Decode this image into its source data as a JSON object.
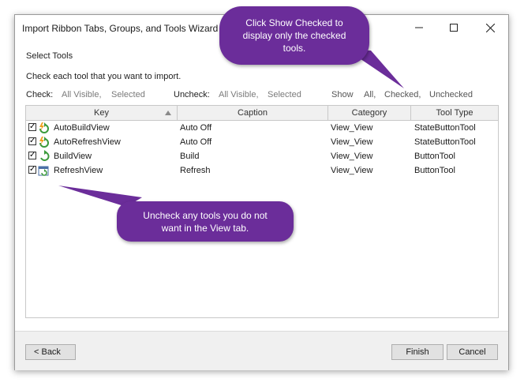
{
  "window": {
    "title": "Import Ribbon Tabs, Groups, and Tools Wizard",
    "controls": {
      "minimize": "—",
      "maximize": "☐",
      "close": "✕"
    }
  },
  "page": {
    "heading": "Select Tools",
    "instruction": "Check each tool that you want to import."
  },
  "filters": {
    "check_label": "Check:",
    "check_all_visible": "All Visible,",
    "check_selected": "Selected",
    "uncheck_label": "Uncheck:",
    "uncheck_all_visible": "All Visible,",
    "uncheck_selected": "Selected",
    "show_label": "Show",
    "show_all": "All,",
    "show_checked": "Checked,",
    "show_unchecked": "Unchecked"
  },
  "grid": {
    "columns": [
      "Key",
      "Caption",
      "Category",
      "Tool Type"
    ],
    "rows": [
      {
        "checked": true,
        "icon": "auto-build-icon",
        "key": "AutoBuildView",
        "caption": "Auto Off",
        "category": "View_View",
        "type": "StateButtonTool"
      },
      {
        "checked": true,
        "icon": "auto-refresh-icon",
        "key": "AutoRefreshView",
        "caption": "Auto Off",
        "category": "View_View",
        "type": "StateButtonTool"
      },
      {
        "checked": true,
        "icon": "build-icon",
        "key": "BuildView",
        "caption": "Build",
        "category": "View_View",
        "type": "ButtonTool"
      },
      {
        "checked": true,
        "icon": "refresh-icon",
        "key": "RefreshView",
        "caption": "Refresh",
        "category": "View_View",
        "type": "ButtonTool"
      }
    ]
  },
  "buttons": {
    "back": "< Back",
    "finish": "Finish",
    "cancel": "Cancel"
  },
  "callouts": {
    "top": "Click Show Checked to display only the checked tools.",
    "bottom": "Uncheck any tools you do not want in the View tab."
  },
  "colors": {
    "callout": "#6b2d9a",
    "accent_green": "#3a9a3a",
    "accent_orange": "#f0a020"
  }
}
